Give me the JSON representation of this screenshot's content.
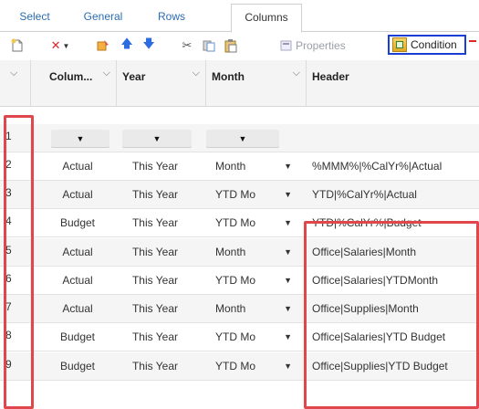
{
  "tabs": [
    {
      "label": "Select"
    },
    {
      "label": "General"
    },
    {
      "label": "Rows"
    },
    {
      "label": "Columns",
      "active": true
    }
  ],
  "toolbar": {
    "new_icon": "new-document-icon",
    "delete_icon": "delete-x-icon",
    "copy_icon": "copy-icon",
    "move_up_icon": "arrow-up-icon",
    "move_down_icon": "arrow-down-icon",
    "cut_icon": "scissors-icon",
    "paste_icon": "paste-icon",
    "paste_special_icon": "clipboard-icon",
    "properties_label": "Properties",
    "condition_label": "Condition",
    "accent_color": "#1a3fd6",
    "delete_color": "#d92b2b"
  },
  "grid": {
    "columns": [
      {
        "label": ""
      },
      {
        "label": "Colum..."
      },
      {
        "label": "Year"
      },
      {
        "label": "Month"
      },
      {
        "label": "Header"
      }
    ],
    "rows": [
      {
        "num": "1",
        "column": "",
        "year": "",
        "month": "",
        "header": ""
      },
      {
        "num": "2",
        "column": "Actual",
        "year": "This Year",
        "month": "Month",
        "header": "%MMM%|%CalYr%|Actual"
      },
      {
        "num": "3",
        "column": "Actual",
        "year": "This Year",
        "month": "YTD Mo",
        "header": "YTD|%CalYr%|Actual"
      },
      {
        "num": "4",
        "column": "Budget",
        "year": "This Year",
        "month": "YTD Mo",
        "header": "YTD|%CalYr%|Budget"
      },
      {
        "num": "5",
        "column": "Actual",
        "year": "This Year",
        "month": "Month",
        "header": "Office|Salaries|Month"
      },
      {
        "num": "6",
        "column": "Actual",
        "year": "This Year",
        "month": "YTD Mo",
        "header": "Office|Salaries|YTDMonth"
      },
      {
        "num": "7",
        "column": "Actual",
        "year": "This Year",
        "month": "Month",
        "header": "Office|Supplies|Month"
      },
      {
        "num": "8",
        "column": "Budget",
        "year": "This Year",
        "month": "YTD Mo",
        "header": "Office|Salaries|YTD Budget"
      },
      {
        "num": "9",
        "column": "Budget",
        "year": "This Year",
        "month": "YTD Mo",
        "header": "Office|Supplies|YTD Budget"
      }
    ]
  },
  "annotation_color": "#e0474c"
}
